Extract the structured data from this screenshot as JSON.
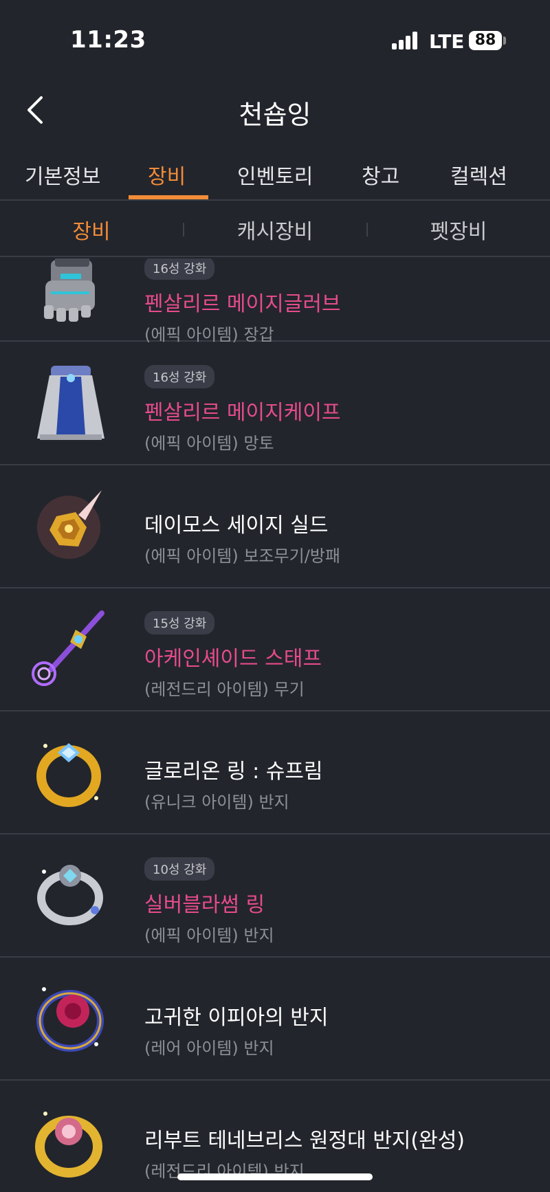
{
  "status": {
    "time": "11:23",
    "network": "LTE",
    "battery": "88"
  },
  "header": {
    "title": "천숍잉"
  },
  "main_tabs": [
    {
      "label": "기본정보"
    },
    {
      "label": "장비"
    },
    {
      "label": "인벤토리"
    },
    {
      "label": "창고"
    },
    {
      "label": "컬렉션"
    }
  ],
  "sub_tabs": [
    {
      "label": "장비"
    },
    {
      "label": "캐시장비"
    },
    {
      "label": "펫장비"
    }
  ],
  "items": [
    {
      "badge": "16성 강화",
      "name": "펜살리르 메이지글러브",
      "sub": "(에픽 아이템) 장갑",
      "icon": "glove-icon"
    },
    {
      "badge": "16성 강화",
      "name": "펜살리르 메이지케이프",
      "sub": "(에픽 아이템) 망토",
      "icon": "cape-icon"
    },
    {
      "badge": "",
      "name": "데이모스 세이지 실드",
      "sub": "(에픽 아이템) 보조무기/방패",
      "icon": "shield-icon"
    },
    {
      "badge": "15성 강화",
      "name": "아케인셰이드 스태프",
      "sub": "(레전드리 아이템) 무기",
      "icon": "staff-icon"
    },
    {
      "badge": "",
      "name": "글로리온 링 : 슈프림",
      "sub": "(유니크 아이템) 반지",
      "icon": "ring-icon"
    },
    {
      "badge": "10성 강화",
      "name": "실버블라썸 링",
      "sub": "(에픽 아이템) 반지",
      "icon": "ring-icon"
    },
    {
      "badge": "",
      "name": "고귀한 이피아의 반지",
      "sub": "(레어 아이템) 반지",
      "icon": "ring-icon"
    },
    {
      "badge": "",
      "name": "리부트 테네브리스 원정대 반지(완성)",
      "sub": "(레전드리 아이템) 반지",
      "icon": "ring-icon"
    }
  ]
}
